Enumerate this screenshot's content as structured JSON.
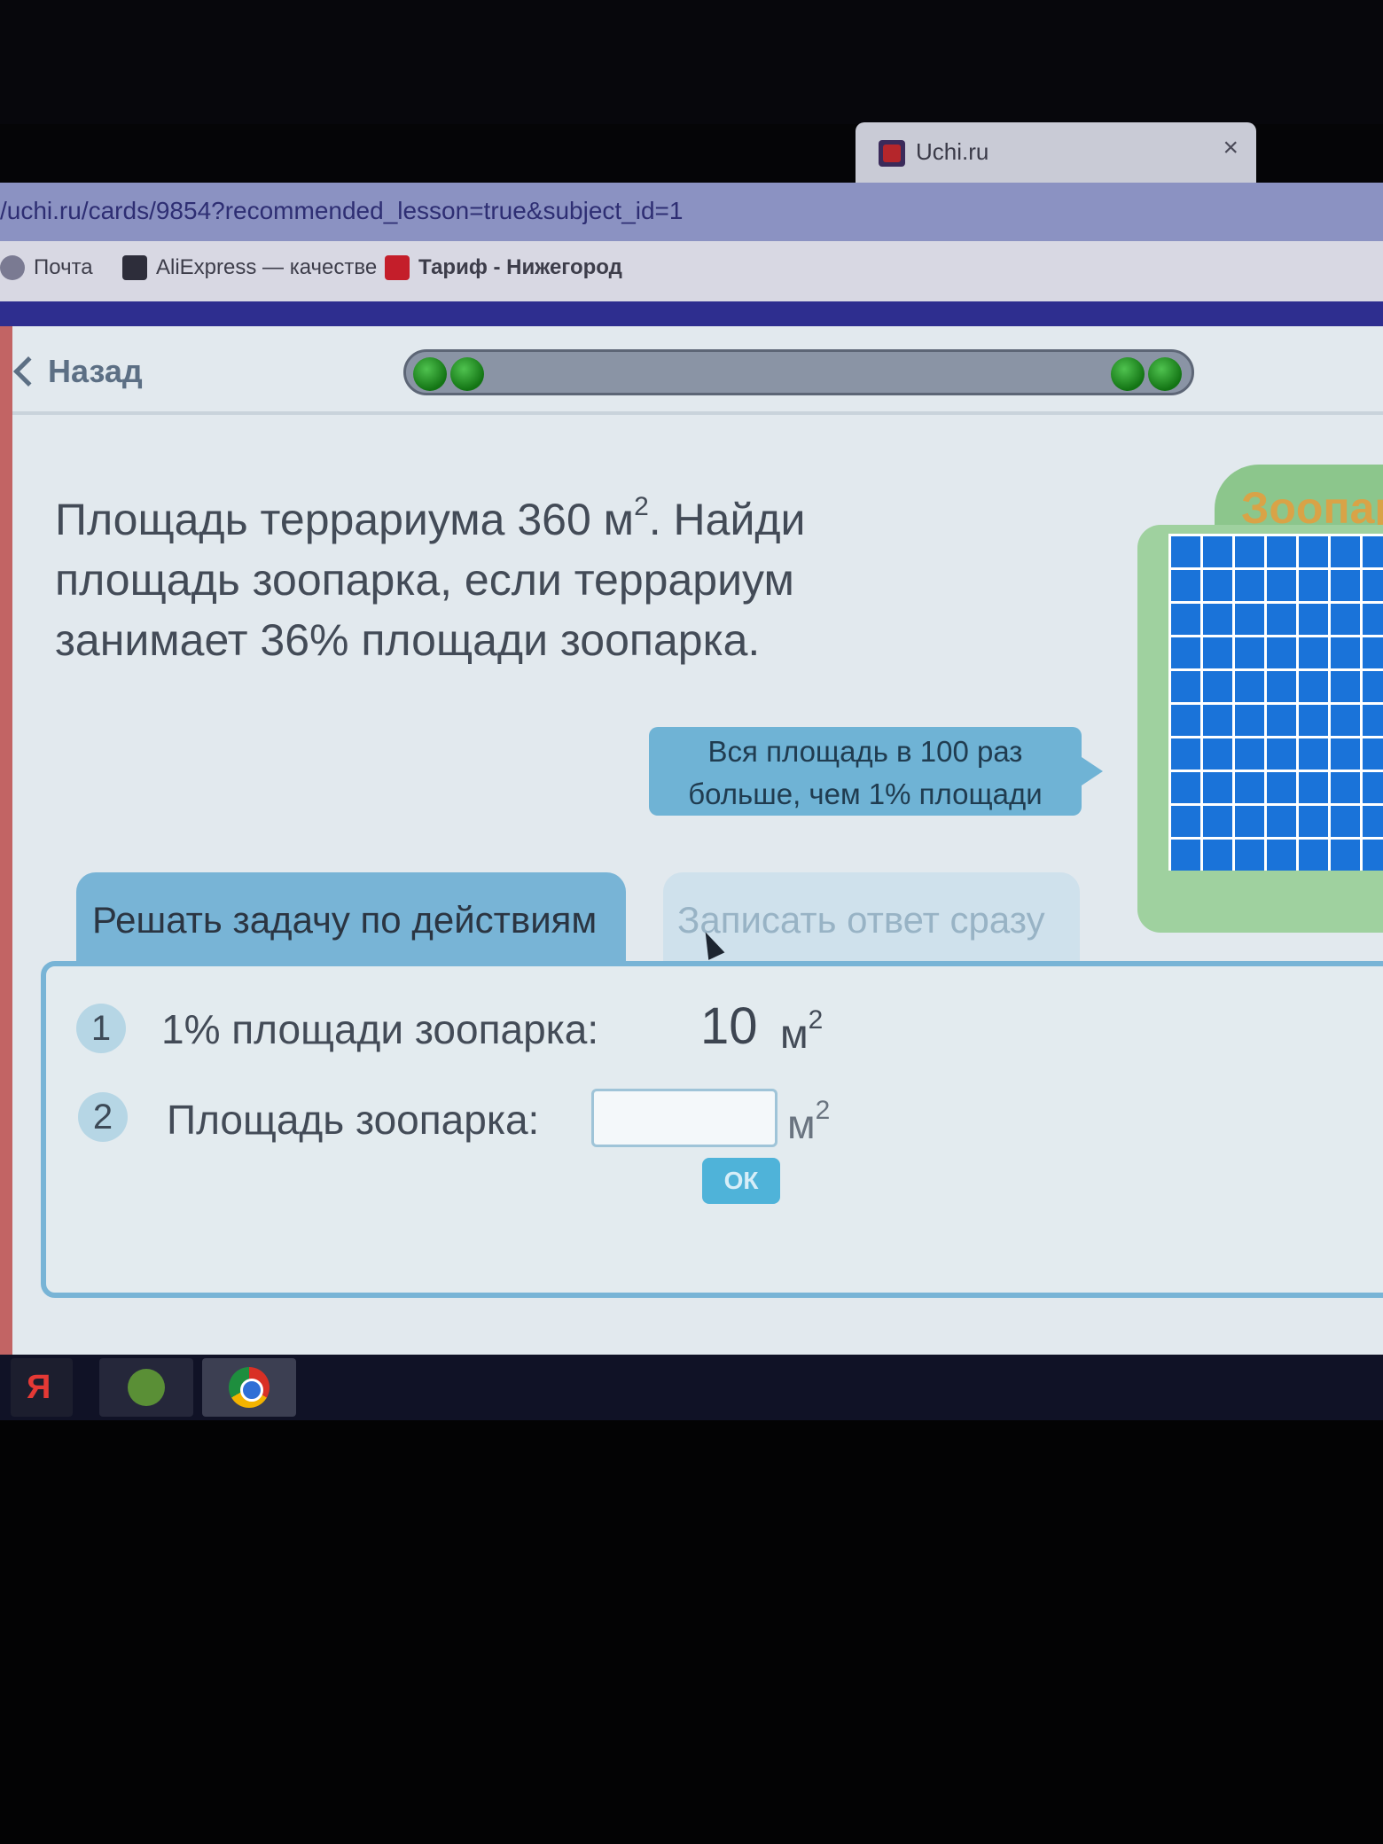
{
  "browser": {
    "tab_title": "Uchi.ru",
    "tab_close": "×",
    "url": "/uchi.ru/cards/9854?recommended_lesson=true&subject_id=1",
    "bookmarks": [
      "Почта",
      "AliExpress — качестве",
      "Тариф - Нижегород"
    ]
  },
  "header": {
    "back_label": "Назад",
    "progress_dots": 4
  },
  "problem": {
    "text_part1": "Площадь террариума 360 м",
    "sup": "2",
    "text_part2": ". Найди площадь зоопарка, если террариум занимает 36% площади зоопарка."
  },
  "illustration": {
    "title": "Зоопар"
  },
  "hint": {
    "text": "Вся площадь в 100 раз больше, чем 1% площади"
  },
  "tabs": {
    "active": "Решать задачу по действиям",
    "inactive": "Записать ответ сразу"
  },
  "steps": [
    {
      "num": "1",
      "label": "1% площади зоопарка:",
      "value": "10",
      "unit": "м",
      "unit_sup": "2"
    },
    {
      "num": "2",
      "label": "Площадь зоопарка:",
      "value": "",
      "unit": "м",
      "unit_sup": "2"
    }
  ],
  "ok_button": "ОК",
  "taskbar": {
    "yandex_glyph": "Я"
  },
  "colors": {
    "accent": "#78b4d6",
    "progress_green": "#2a9a2a",
    "zoo_blue": "#1a73d9"
  }
}
